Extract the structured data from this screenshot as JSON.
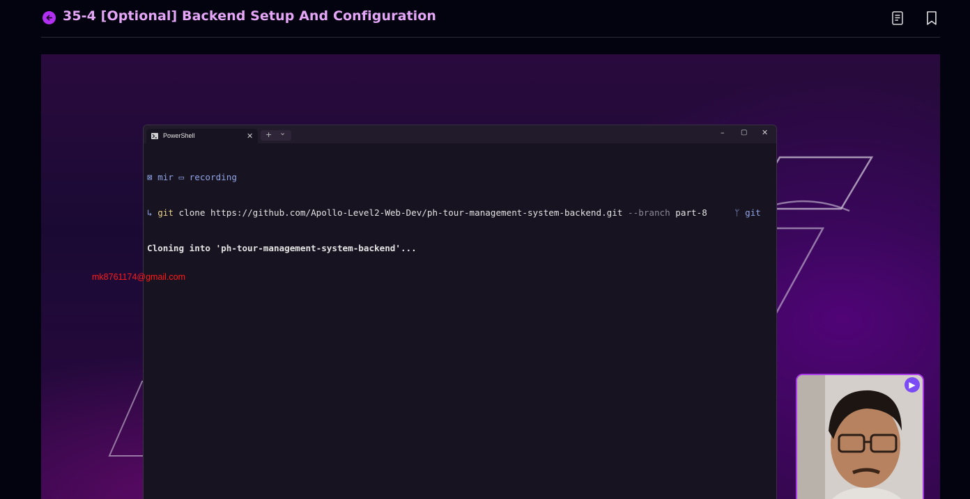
{
  "header": {
    "title": "35-4 [Optional] Backend Setup And Configuration",
    "back_icon": "arrow-left-circle-icon",
    "notes_icon": "document-icon",
    "bookmark_icon": "bookmark-icon"
  },
  "terminal": {
    "tab_label": "PowerShell",
    "tab_close": "✕",
    "new_tab": "+",
    "dropdown": "⌄",
    "minimize": "–",
    "maximize": "▢",
    "close": "✕",
    "prompt_user": "mir",
    "prompt_dir": "recording",
    "cmd_arrow": "↳",
    "cmd_git": "git",
    "cmd_main": "clone https://github.com/Apollo-Level2-Web-Dev/ph-tour-management-system-backend.git",
    "cmd_flag": "--branch",
    "cmd_branch": "part-8",
    "right_status": "git",
    "output": "Cloning into 'ph-tour-management-system-backend'..."
  },
  "watermark": "mk8761174@gmail.com",
  "colors": {
    "accent": "#b12ff0",
    "title": "#e6a6f8",
    "watermark": "#ff1a1a"
  }
}
